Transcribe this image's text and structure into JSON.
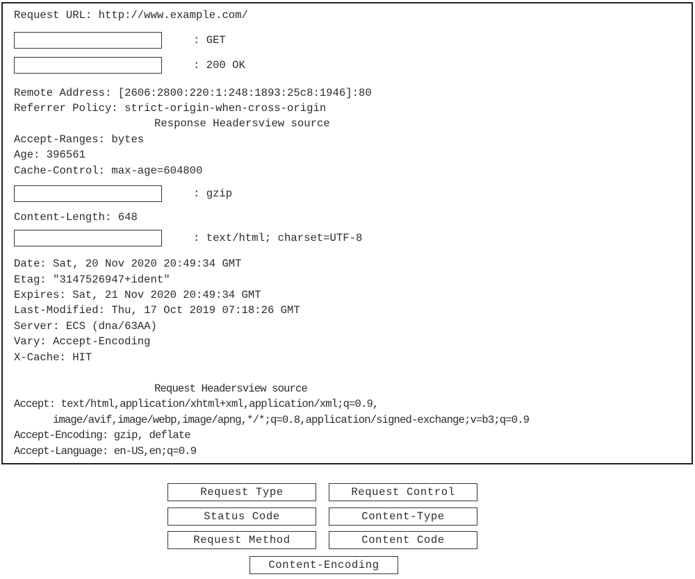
{
  "general": {
    "request_url": "Request URL: http://www.example.com/",
    "blank1_value": ": GET",
    "blank2_value": ": 200 OK",
    "remote_address": "Remote Address: [2606:2800:220:1:248:1893:25c8:1946]:80",
    "referrer_policy": "Referrer Policy: strict-origin-when-cross-origin"
  },
  "response_headers": {
    "title": "Response Headersview source",
    "accept_ranges": "Accept-Ranges: bytes",
    "age": "Age: 396561",
    "cache_control": "Cache-Control: max-age=604800",
    "blank3_value": ": gzip",
    "content_length": "Content-Length: 648",
    "blank4_value": ": text/html; charset=UTF-8",
    "date": "Date: Sat, 20 Nov 2020 20:49:34 GMT",
    "etag": "Etag: \"3147526947+ident\"",
    "expires": "Expires: Sat, 21 Nov 2020 20:49:34 GMT",
    "last_modified": "Last-Modified: Thu, 17 Oct 2019 07:18:26 GMT",
    "server": "Server: ECS (dna/63AA)",
    "vary": "Vary: Accept-Encoding",
    "x_cache": "X-Cache: HIT"
  },
  "request_headers": {
    "title": "Request Headersview source",
    "accept_line1": "Accept: text/html,application/xhtml+xml,application/xml;q=0.9,",
    "accept_line2": "image/avif,image/webp,image/apng,*/*;q=0.8,application/signed-exchange;v=b3;q=0.9",
    "accept_encoding": "Accept-Encoding: gzip, deflate",
    "accept_language": "Accept-Language: en-US,en;q=0.9"
  },
  "choices": [
    "Request Type",
    "Request Control",
    "Status Code",
    "Content-Type",
    "Request Method",
    "Content Code",
    "Content-Encoding"
  ]
}
